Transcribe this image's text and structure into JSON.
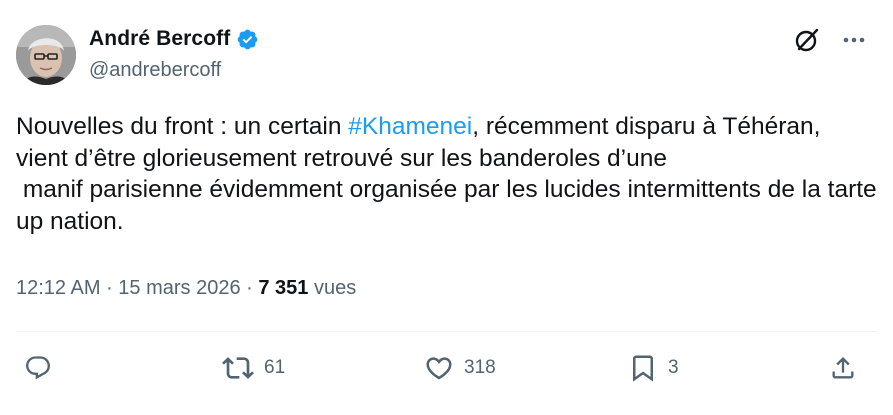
{
  "author": {
    "display_name": "André Bercoff",
    "handle": "@andrebercoff",
    "verified": true,
    "verified_color": "#1d9bf0"
  },
  "tweet": {
    "text_before": "Nouvelles du front : un certain ",
    "hashtag": "#Khamenei",
    "text_after": ", récemment disparu à Téhéran, vient d’être glorieusement retrouvé sur les banderoles d’une\n manif parisienne évidemment organisée par les lucides intermittents de la tarte up nation.",
    "hashtag_color": "#1d9bf0"
  },
  "meta": {
    "time": "12:12 AM",
    "separator": " · ",
    "date": "15 mars 2026",
    "views_count": "7 351",
    "views_label": " vues"
  },
  "actions": {
    "replies": "",
    "retweets": "61",
    "likes": "318",
    "bookmarks": "3"
  },
  "icons": {
    "grok": "grok-icon",
    "more": "more-icon",
    "reply": "reply-icon",
    "retweet": "retweet-icon",
    "like": "heart-icon",
    "bookmark": "bookmark-icon",
    "share": "share-icon"
  },
  "colors": {
    "text": "#0f1419",
    "secondary": "#536471",
    "accent": "#1d9bf0",
    "divider": "#eff3f4"
  }
}
